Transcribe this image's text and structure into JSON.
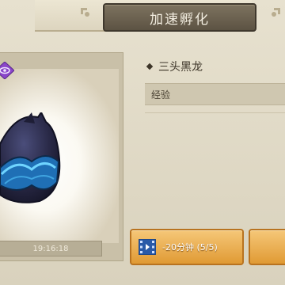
{
  "header": {
    "title": "加速孵化"
  },
  "egg": {
    "timer": "19:16:18"
  },
  "dragon": {
    "name": "三头黑龙",
    "exp_label": "经验"
  },
  "buttons": {
    "video_speedup": "-20分钟 (5/5)"
  },
  "colors": {
    "button_orange": "#e09a34",
    "title_plate": "#5c5343",
    "egg_accent": "#3fa4e0",
    "badge_purple": "#8a45c9"
  }
}
